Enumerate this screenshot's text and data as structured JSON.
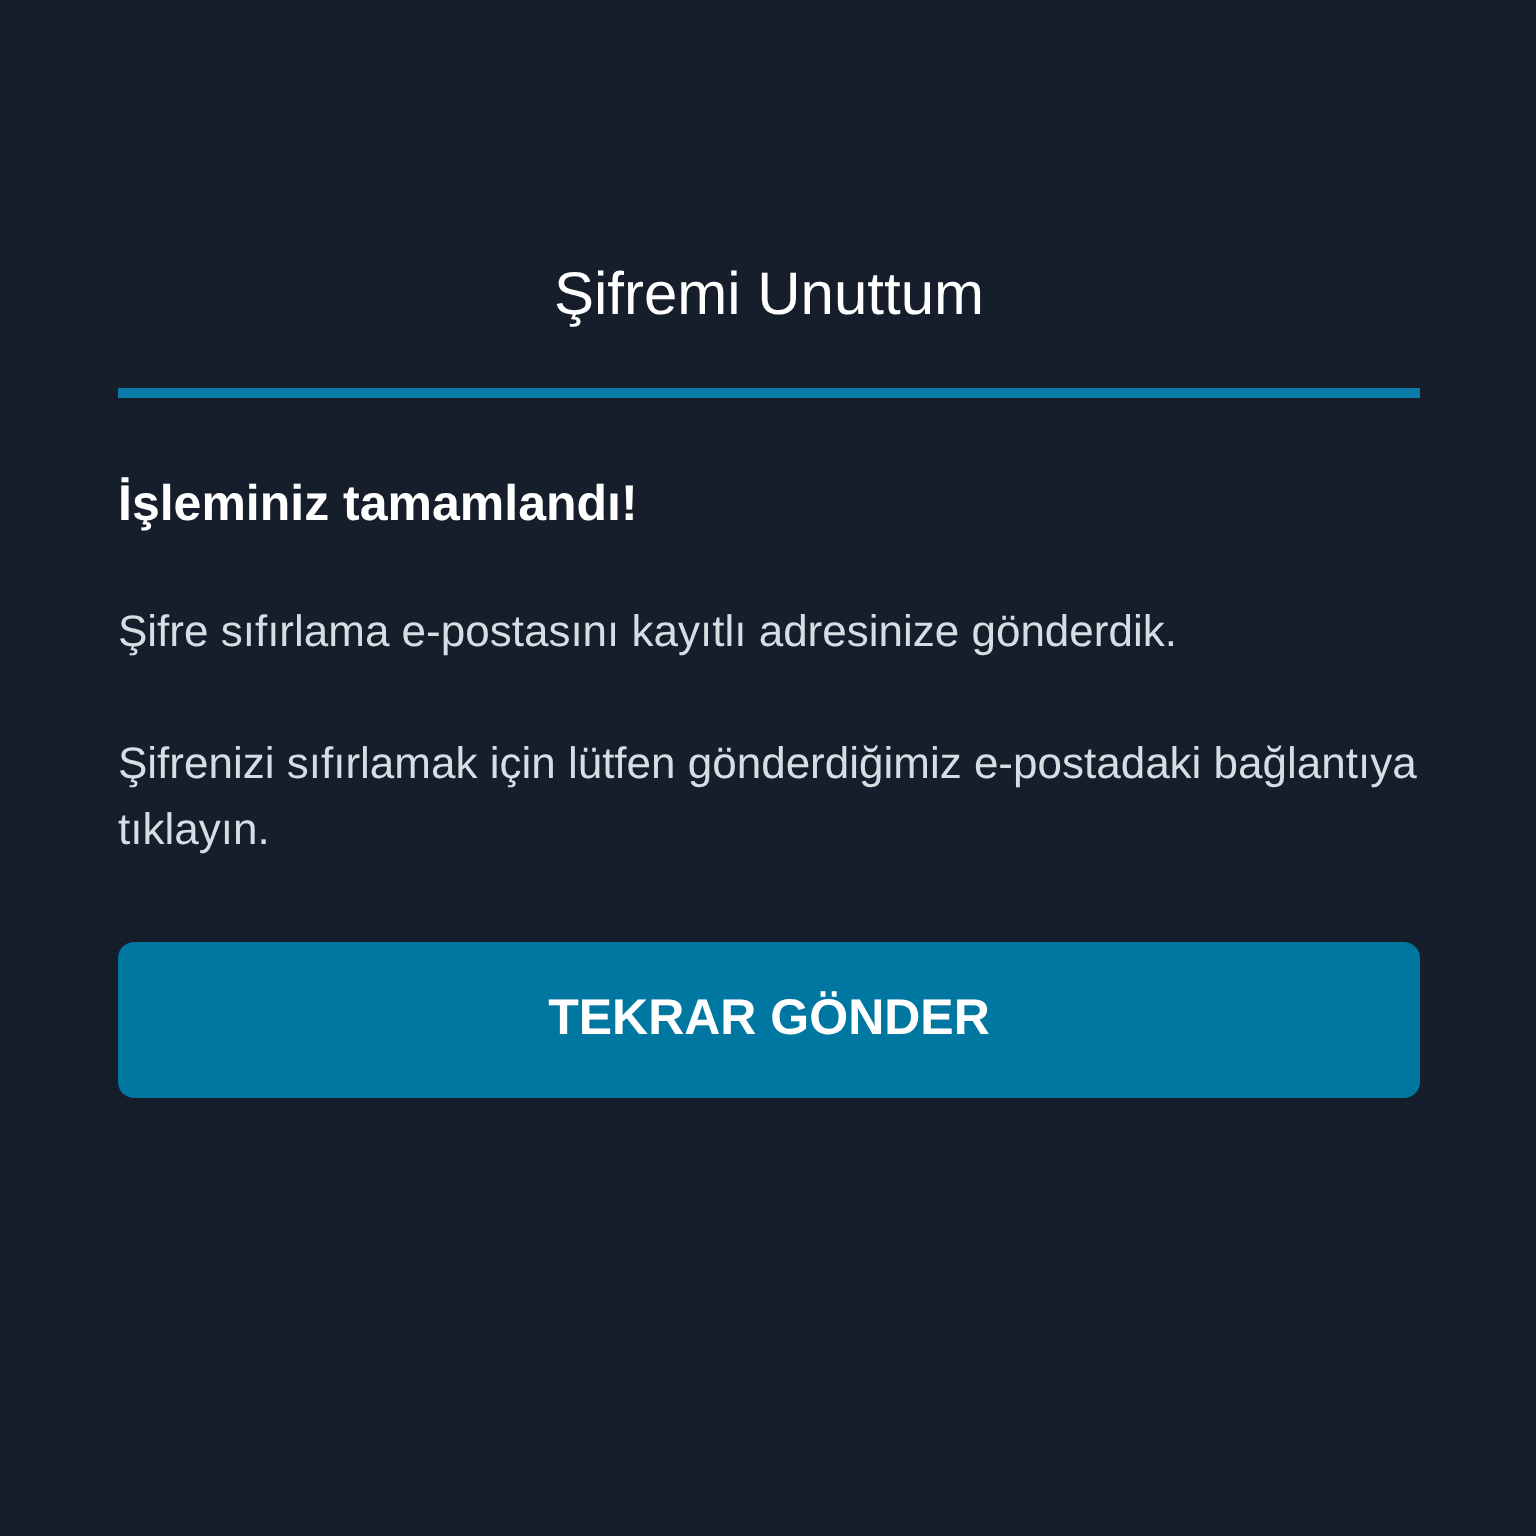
{
  "title": "Şifremi Unuttum",
  "heading": "İşleminiz tamamlandı!",
  "paragraphs": [
    "Şifre sıfırlama e-postasını kayıtlı adresinize gönderdik.",
    "Şifrenizi sıfırlamak için lütfen gönderdiğimiz e-postadaki bağlantıya tıklayın."
  ],
  "button": {
    "label": "TEKRAR GÖNDER"
  }
}
